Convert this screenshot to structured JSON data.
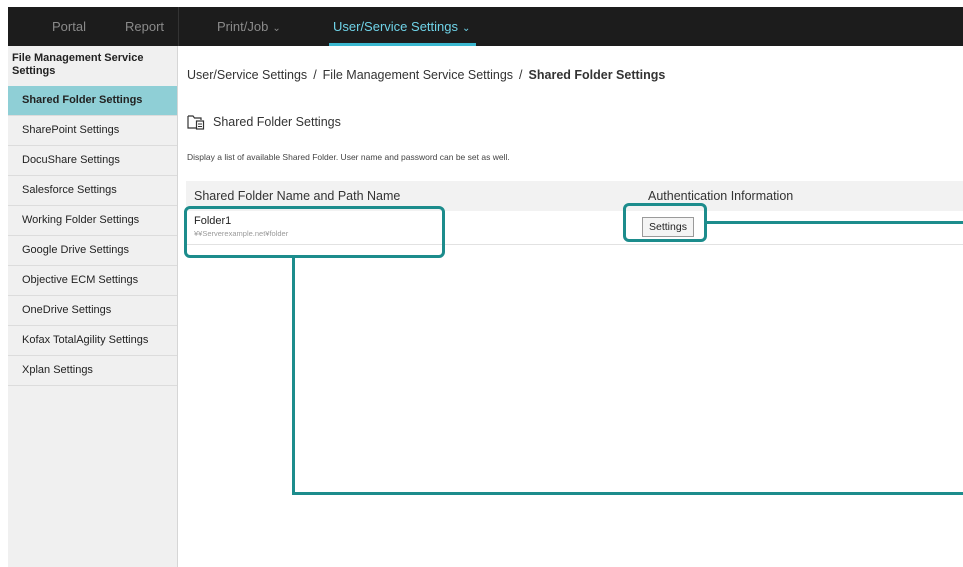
{
  "nav": {
    "items": [
      {
        "label": "Portal",
        "active": false
      },
      {
        "label": "Report",
        "active": false
      },
      {
        "label": "Print/Job",
        "active": false,
        "dropdown": true
      },
      {
        "label": "User/Service Settings",
        "active": true,
        "dropdown": true
      }
    ]
  },
  "sidebar": {
    "heading": "File Management Service Settings",
    "items": [
      {
        "label": "Shared Folder Settings",
        "active": true
      },
      {
        "label": "SharePoint Settings"
      },
      {
        "label": "DocuShare Settings"
      },
      {
        "label": "Salesforce Settings"
      },
      {
        "label": "Working Folder Settings"
      },
      {
        "label": "Google Drive Settings"
      },
      {
        "label": "Objective ECM Settings"
      },
      {
        "label": "OneDrive Settings"
      },
      {
        "label": "Kofax TotalAgility Settings"
      },
      {
        "label": "Xplan Settings"
      }
    ]
  },
  "breadcrumb": {
    "items": [
      "User/Service Settings",
      "File Management Service Settings"
    ],
    "current": "Shared Folder Settings",
    "separator": "/"
  },
  "page": {
    "title": "Shared Folder Settings",
    "description": "Display a list of available Shared Folder. User name and password can be set as well."
  },
  "table": {
    "headers": [
      "Shared Folder Name and Path Name",
      "Authentication Information"
    ],
    "rows": [
      {
        "name": "Folder1",
        "path": "¥¥Serverexample.net¥folder",
        "button": "Settings"
      }
    ]
  },
  "colors": {
    "accent": "#3ab7cf",
    "sidebar_active": "#8fcfd6",
    "callout": "#1c8c8c"
  }
}
